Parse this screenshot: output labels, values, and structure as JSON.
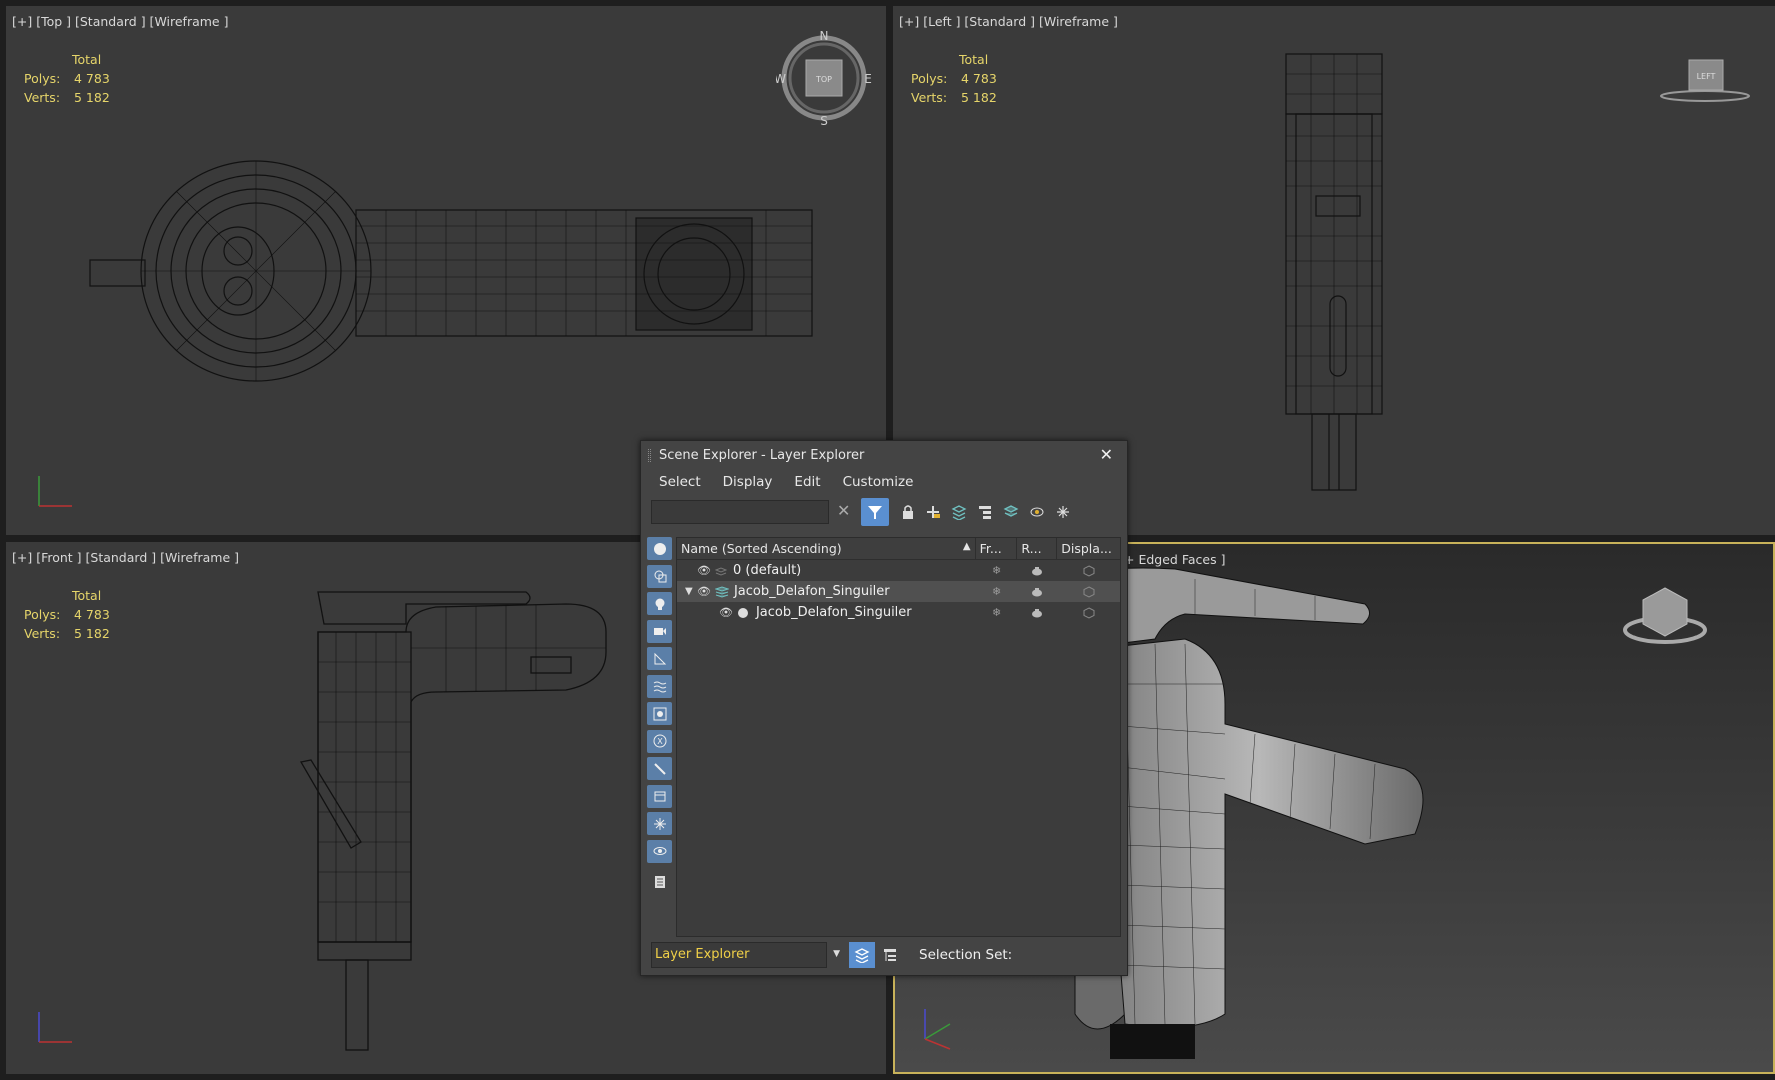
{
  "viewports": {
    "top": {
      "label": "[+] [Top ] [Standard ] [Wireframe ]",
      "stats": {
        "total_label": "Total",
        "polys_label": "Polys:",
        "polys_value": "4 783",
        "verts_label": "Verts:",
        "verts_value": "5 182"
      },
      "compass": {
        "n": "N",
        "s": "S",
        "e": "E",
        "w": "W",
        "cube_face": "TOP"
      }
    },
    "left": {
      "label": "[+] [Left ] [Standard ] [Wireframe ]",
      "stats": {
        "total_label": "Total",
        "polys_label": "Polys:",
        "polys_value": "4 783",
        "verts_label": "Verts:",
        "verts_value": "5 182"
      },
      "cube_face": "LEFT"
    },
    "front": {
      "label": "[+] [Front ] [Standard ] [Wireframe ]",
      "stats": {
        "total_label": "Total",
        "polys_label": "Polys:",
        "polys_value": "4 783",
        "verts_label": "Verts:",
        "verts_value": "5 182"
      }
    },
    "perspective": {
      "label": "+ Edged Faces ]"
    }
  },
  "explorer": {
    "title": "Scene Explorer - Layer Explorer",
    "menu": [
      "Select",
      "Display",
      "Edit",
      "Customize"
    ],
    "search_value": "",
    "columns": {
      "name": "Name (Sorted Ascending)",
      "freeze": "Fr...",
      "render": "R...",
      "display": "Displa..."
    },
    "rows": [
      {
        "name": "0 (default)",
        "indent": 0
      },
      {
        "name": "Jacob_Delafon_Singuiler",
        "indent": 0
      },
      {
        "name": "Jacob_Delafon_Singuiler",
        "indent": 1
      }
    ],
    "footer": {
      "mode": "Layer Explorer",
      "selection_set_label": "Selection Set:"
    }
  },
  "colors": {
    "viewport_bg": "#3a3a3a",
    "stats": "#e6d56a",
    "active_border": "#c8b25a",
    "accent": "#5a8fd0"
  }
}
